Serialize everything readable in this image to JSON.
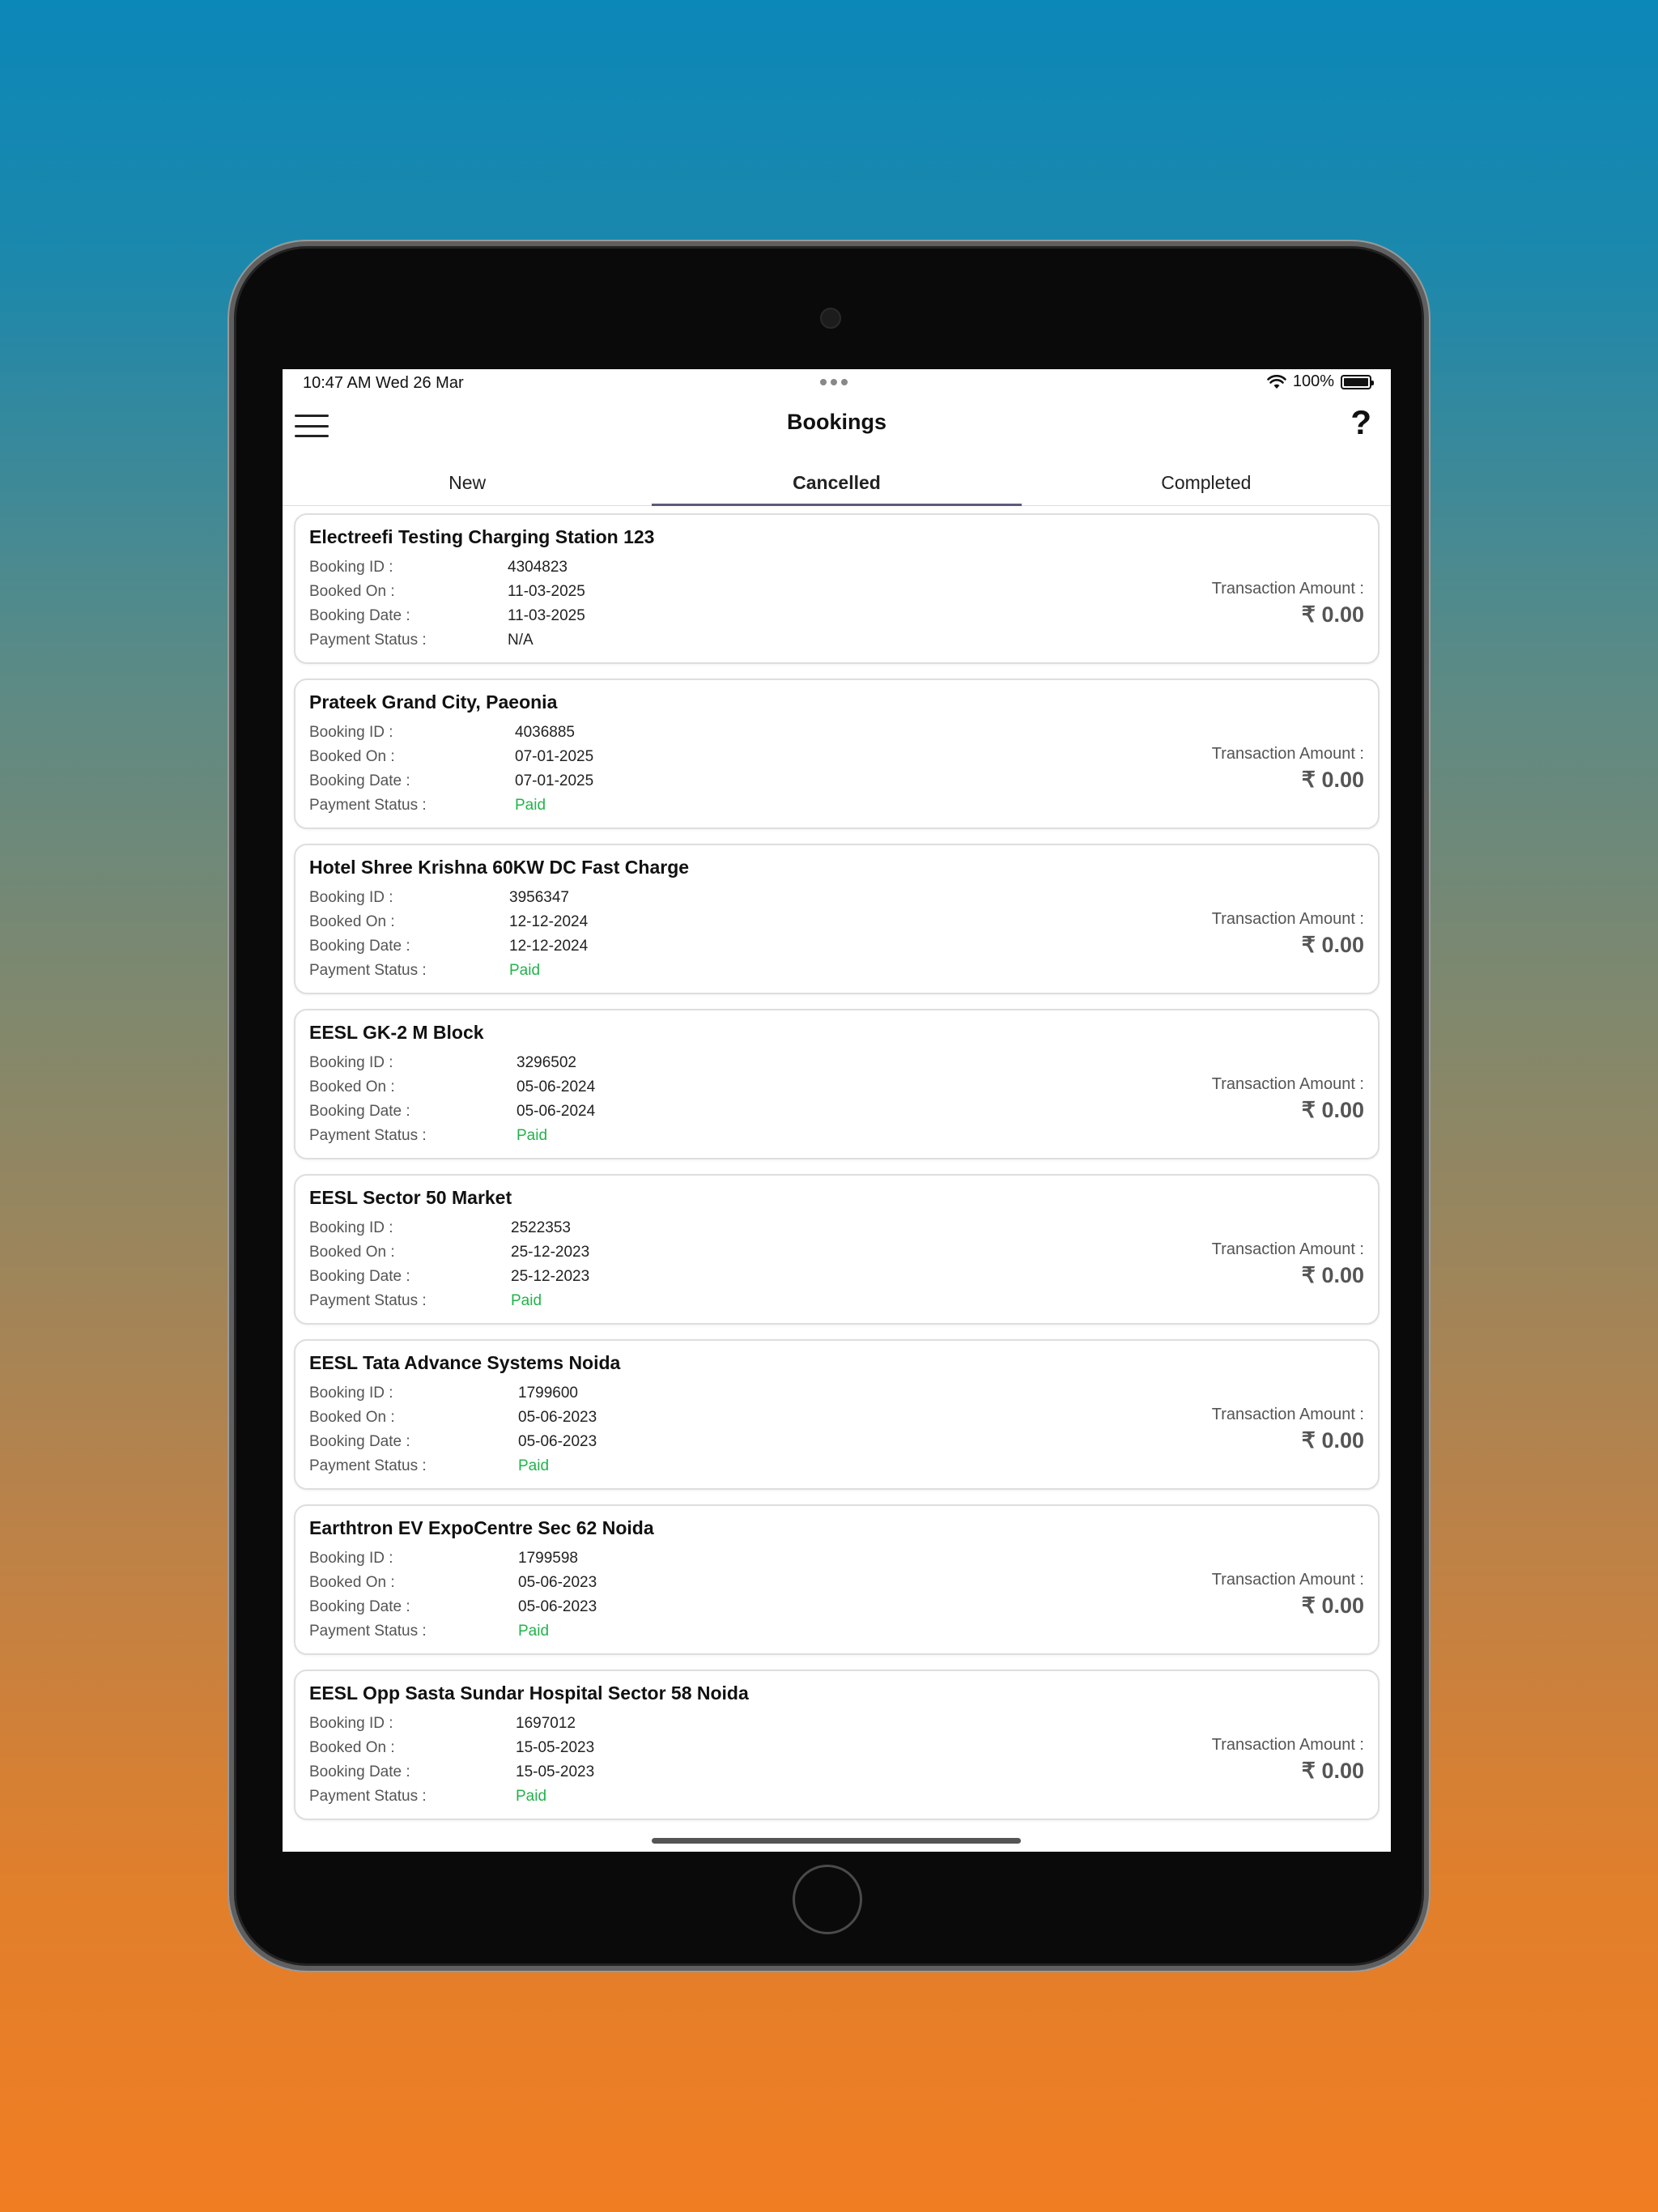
{
  "status_bar": {
    "time": "10:47 AM   Wed 26 Mar",
    "battery": "100%"
  },
  "navbar": {
    "title": "Bookings"
  },
  "tabs": [
    {
      "label": "New"
    },
    {
      "label": "Cancelled"
    },
    {
      "label": "Completed"
    }
  ],
  "active_tab": "Cancelled",
  "field_labels": {
    "booking_id": "Booking ID :",
    "booked_on": "Booked On :",
    "booking_date": "Booking Date :",
    "payment_status": "Payment Status :",
    "transaction_amount": "Transaction Amount :"
  },
  "bookings": [
    {
      "station": "Electreefi Testing Charging Station 123",
      "booking_id": "4304823",
      "booked_on": "11-03-2025",
      "booking_date": "11-03-2025",
      "payment_status": "N/A",
      "amount": "₹ 0.00"
    },
    {
      "station": "Prateek Grand City, Paeonia",
      "booking_id": "4036885",
      "booked_on": "07-01-2025",
      "booking_date": "07-01-2025",
      "payment_status": "Paid",
      "amount": "₹ 0.00"
    },
    {
      "station": "Hotel Shree Krishna 60KW DC Fast Charge",
      "booking_id": "3956347",
      "booked_on": "12-12-2024",
      "booking_date": "12-12-2024",
      "payment_status": "Paid",
      "amount": "₹ 0.00"
    },
    {
      "station": "EESL GK-2 M Block",
      "booking_id": "3296502",
      "booked_on": "05-06-2024",
      "booking_date": "05-06-2024",
      "payment_status": "Paid",
      "amount": "₹ 0.00"
    },
    {
      "station": "EESL Sector 50 Market",
      "booking_id": "2522353",
      "booked_on": "25-12-2023",
      "booking_date": "25-12-2023",
      "payment_status": "Paid",
      "amount": "₹ 0.00"
    },
    {
      "station": "EESL Tata Advance Systems Noida",
      "booking_id": "1799600",
      "booked_on": "05-06-2023",
      "booking_date": "05-06-2023",
      "payment_status": "Paid",
      "amount": "₹ 0.00"
    },
    {
      "station": "Earthtron EV ExpoCentre Sec 62 Noida",
      "booking_id": "1799598",
      "booked_on": "05-06-2023",
      "booking_date": "05-06-2023",
      "payment_status": "Paid",
      "amount": "₹ 0.00"
    },
    {
      "station": "EESL Opp Sasta Sundar Hospital Sector 58 Noida",
      "booking_id": "1697012",
      "booked_on": "15-05-2023",
      "booking_date": "15-05-2023",
      "payment_status": "Paid",
      "amount": "₹ 0.00"
    }
  ],
  "colors": {
    "paid": "#22b34b",
    "active_tab_underline": "#5b5b7a"
  },
  "icons": {
    "menu": "hamburger-menu-icon",
    "help": "question-mark-icon",
    "wifi": "wifi-icon",
    "battery": "battery-icon"
  }
}
